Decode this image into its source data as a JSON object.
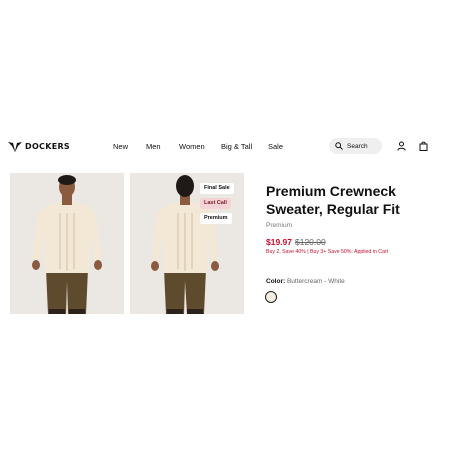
{
  "header": {
    "logo": "DOCKERS",
    "nav": [
      "New",
      "Men",
      "Women",
      "Big & Tall",
      "Sale"
    ],
    "search_label": "Search"
  },
  "gallery": {
    "badges": [
      "Final Sale",
      "Last Call",
      "Premium"
    ]
  },
  "product": {
    "title": "Premium Crewneck Sweater, Regular Fit",
    "subtitle": "Premium",
    "sale_price": "$19.97",
    "original_price": "$120.00",
    "promo": "Buy 2, Save 40% | Buy 3+ Save 50%: Applied in Cart",
    "color_label": "Color:",
    "color_value": "Buttercream - White",
    "swatch_color": "#f4ede0"
  },
  "colors": {
    "accent_red": "#c8102e",
    "badge_pink": "#f6d3d7"
  },
  "icons": [
    "search-icon",
    "user-icon",
    "bag-icon",
    "dockers-wing-logo-icon"
  ]
}
